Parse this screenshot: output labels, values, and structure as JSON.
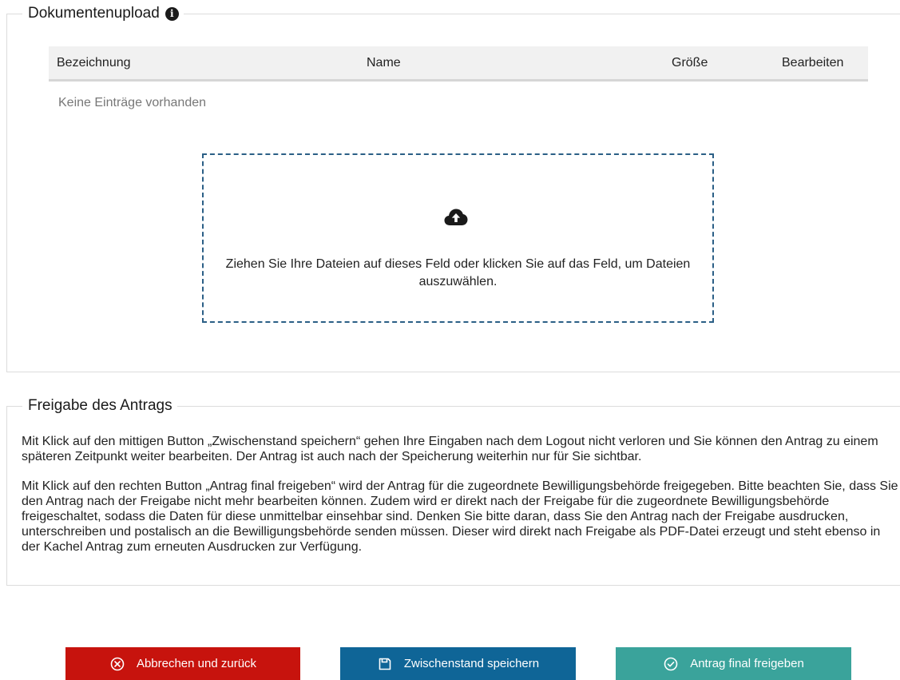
{
  "upload": {
    "legend": "Dokumentenupload",
    "info_icon": "info-circle-icon",
    "table": {
      "headers": [
        "Bezeichnung",
        "Name",
        "Größe",
        "Bearbeiten"
      ],
      "empty_text": "Keine Einträge vorhanden"
    },
    "dropzone": {
      "icon": "cloud-upload-icon",
      "text": "Ziehen Sie Ihre Dateien auf dieses Feld oder klicken Sie auf das Feld, um Dateien auszuwählen."
    }
  },
  "release": {
    "legend": "Freigabe des Antrags",
    "paragraphs": [
      "Mit Klick auf den mittigen Button „Zwischenstand speichern“ gehen Ihre Eingaben nach dem Logout nicht verloren und Sie können den Antrag zu einem späteren Zeitpunkt weiter bearbeiten. Der Antrag ist auch nach der Speicherung weiterhin nur für Sie sichtbar.",
      "Mit Klick auf den rechten Button „Antrag final freigeben“ wird der Antrag für die zugeordnete Bewilligungsbehörde freigegeben. Bitte beachten Sie, dass Sie den Antrag nach der Freigabe nicht mehr bearbeiten können. Zudem wird er direkt nach der Freigabe für die zugeordnete Bewilligungsbehörde freigeschaltet, sodass die Daten für diese unmittelbar einsehbar sind. Denken Sie bitte daran, dass Sie den Antrag nach der Freigabe ausdrucken, unterschreiben und postalisch an die Bewilligungsbehörde senden müssen. Dieser wird direkt nach Freigabe als PDF-Datei erzeugt und steht ebenso in der Kachel Antrag zum erneuten Ausdrucken zur Verfügung."
    ]
  },
  "buttons": {
    "cancel": {
      "label": "Abbrechen und zurück",
      "icon": "x-circle-icon",
      "color": "#c7130d"
    },
    "save": {
      "label": "Zwischenstand speichern",
      "icon": "save-icon",
      "color": "#0f6597"
    },
    "final": {
      "label": "Antrag final freigeben",
      "icon": "check-circle-icon",
      "color": "#3aa39b"
    }
  },
  "colors": {
    "dropzone_border": "#2b5f86",
    "table_header_bg": "#f1f1f1"
  }
}
